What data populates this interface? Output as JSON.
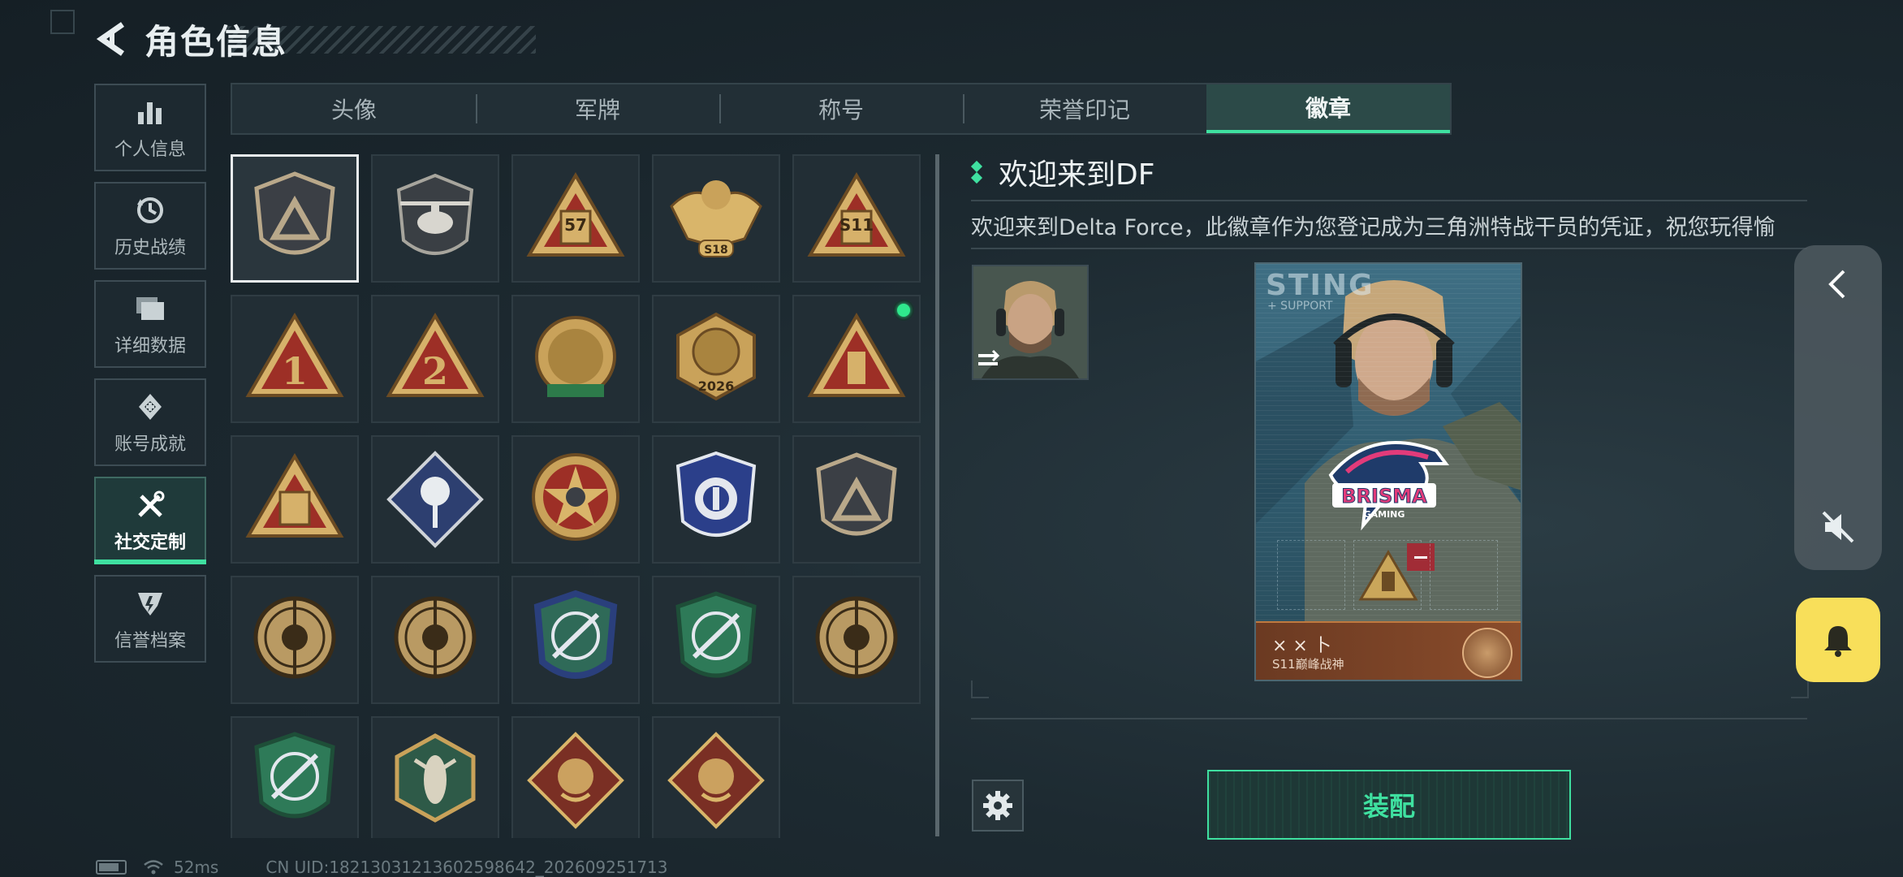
{
  "header": {
    "title": "角色信息"
  },
  "sidebar": {
    "items": [
      {
        "label": "个人信息",
        "icon": "bar-chart-icon"
      },
      {
        "label": "历史战绩",
        "icon": "history-clock-icon"
      },
      {
        "label": "详细数据",
        "icon": "folder-icon"
      },
      {
        "label": "账号成就",
        "icon": "achievement-icon"
      },
      {
        "label": "社交定制",
        "icon": "tools-icon",
        "active": true
      },
      {
        "label": "信誉档案",
        "icon": "reputation-icon"
      }
    ]
  },
  "tabs": [
    {
      "label": "头像"
    },
    {
      "label": "军牌"
    },
    {
      "label": "称号"
    },
    {
      "label": "荣誉印记"
    },
    {
      "label": "徽章",
      "active": true
    }
  ],
  "badges": {
    "selected_index": 0,
    "new_index": 9,
    "items": [
      {
        "label": "",
        "text": ""
      },
      {
        "label": "",
        "text": ""
      },
      {
        "label": "",
        "text": "57"
      },
      {
        "label": "",
        "text": "S18"
      },
      {
        "label": "",
        "text": "S11"
      },
      {
        "label": "",
        "text": "1"
      },
      {
        "label": "",
        "text": "2"
      },
      {
        "label": "",
        "text": ""
      },
      {
        "label": "",
        "text": "2026"
      },
      {
        "label": "",
        "text": ""
      },
      {
        "label": "",
        "text": ""
      },
      {
        "label": "",
        "text": ""
      },
      {
        "label": "",
        "text": ""
      },
      {
        "label": "",
        "text": ""
      },
      {
        "label": "",
        "text": ""
      },
      {
        "label": "",
        "text": ""
      },
      {
        "label": "",
        "text": ""
      },
      {
        "label": "",
        "text": ""
      },
      {
        "label": "",
        "text": ""
      },
      {
        "label": "",
        "text": ""
      },
      {
        "label": "",
        "text": ""
      },
      {
        "label": "",
        "text": ""
      },
      {
        "label": "",
        "text": ""
      },
      {
        "label": "",
        "text": ""
      }
    ]
  },
  "detail": {
    "title": "欢迎来到DF",
    "description": "欢迎来到Delta Force，此徽章作为您登记成为三角洲特战干员的凭证，祝您玩得愉",
    "equip_label": "装配"
  },
  "preview_card": {
    "code": "STING",
    "role": "+ SUPPORT",
    "player_name": "× × 卜",
    "player_title": "S11巅峰战神",
    "logo_text": "BRISMA",
    "logo_sub": "GAMING"
  },
  "status_bar": {
    "ping": "52ms",
    "uid": "CN UID:18213031213602598642_202609251713"
  },
  "colors": {
    "accent": "#3fe0a0",
    "bell": "#f8df5a",
    "new_dot": "#2fe88c",
    "minus": "#a12c36"
  }
}
